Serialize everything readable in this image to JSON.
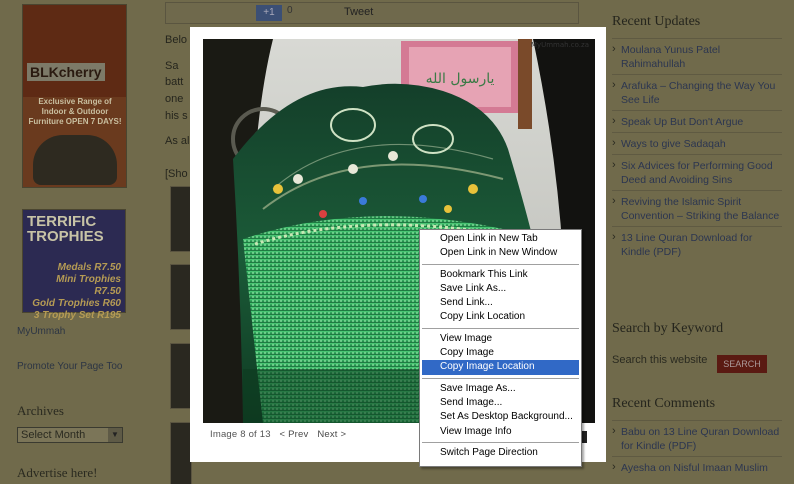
{
  "left_sidebar": {
    "ad_blkcherry": {
      "logo": "BLKcherry",
      "tagline": "Exclusive Range of Indoor & Outdoor Furniture OPEN 7 DAYS!"
    },
    "ad_trophies": {
      "title_line1": "TERRIFIC",
      "title_line2": "TROPHIES",
      "lines": [
        "Medals R7.50",
        "Mini Trophies R7.50",
        "Gold Trophies R60",
        "3 Trophy Set R195"
      ]
    },
    "link_myummah": "MyUmmah",
    "link_promote": "Promote Your Page Too",
    "archives_heading": "Archives",
    "archives_select": "Select Month",
    "advertise_heading": "Advertise here!"
  },
  "share_bar": {
    "plus_label": "+1",
    "count": "0",
    "tweet_label": "Tweet"
  },
  "main_text": {
    "line1": "Belo",
    "line2": "Sa",
    "line3": "batt",
    "line4": "one",
    "line5": "his s",
    "line6": "As al",
    "line7": "[Sho"
  },
  "right_sidebar": {
    "recent_updates_heading": "Recent Updates",
    "recent_updates": [
      "Moulana Yunus Patel Rahimahullah",
      "Arafuka – Changing the Way You See Life",
      "Speak Up But Don't Argue",
      "Ways to give Sadaqah",
      "Six Advices for Performing Good Deed and Avoiding Sins",
      "Reviving the Islamic Spirit Convention – Striking the Balance",
      "13 Line Quran Download for Kindle (PDF)"
    ],
    "search_heading": "Search by Keyword",
    "search_placeholder": "Search this website",
    "search_button": "SEARCH",
    "comments_heading": "Recent Comments",
    "comments": [
      {
        "author": "Babu",
        "on": "on",
        "post": "13 Line Quran Download for Kindle (PDF)"
      },
      {
        "author": "Ayesha",
        "on": "on",
        "post": "Nisful Imaan Muslim"
      }
    ]
  },
  "lightbox": {
    "watermark": "MyUmmah.co.za",
    "frame_text": "يارسول الله",
    "caption": "Image 8 of 13",
    "prev_label": "< Prev",
    "next_label": "Next >"
  },
  "context_menu": {
    "groups": [
      [
        "Open Link in New Tab",
        "Open Link in New Window"
      ],
      [
        "Bookmark This Link",
        "Save Link As...",
        "Send Link...",
        "Copy Link Location"
      ],
      [
        "View Image",
        "Copy Image",
        "Copy Image Location"
      ],
      [
        "Save Image As...",
        "Send Image...",
        "Set As Desktop Background...",
        "View Image Info"
      ],
      [
        "Switch Page Direction"
      ]
    ],
    "highlighted": "Copy Image Location"
  },
  "colors": {
    "overlay_bg": "#706a4b",
    "menu_highlight": "#3169c6",
    "search_button": "#5a1a12"
  }
}
